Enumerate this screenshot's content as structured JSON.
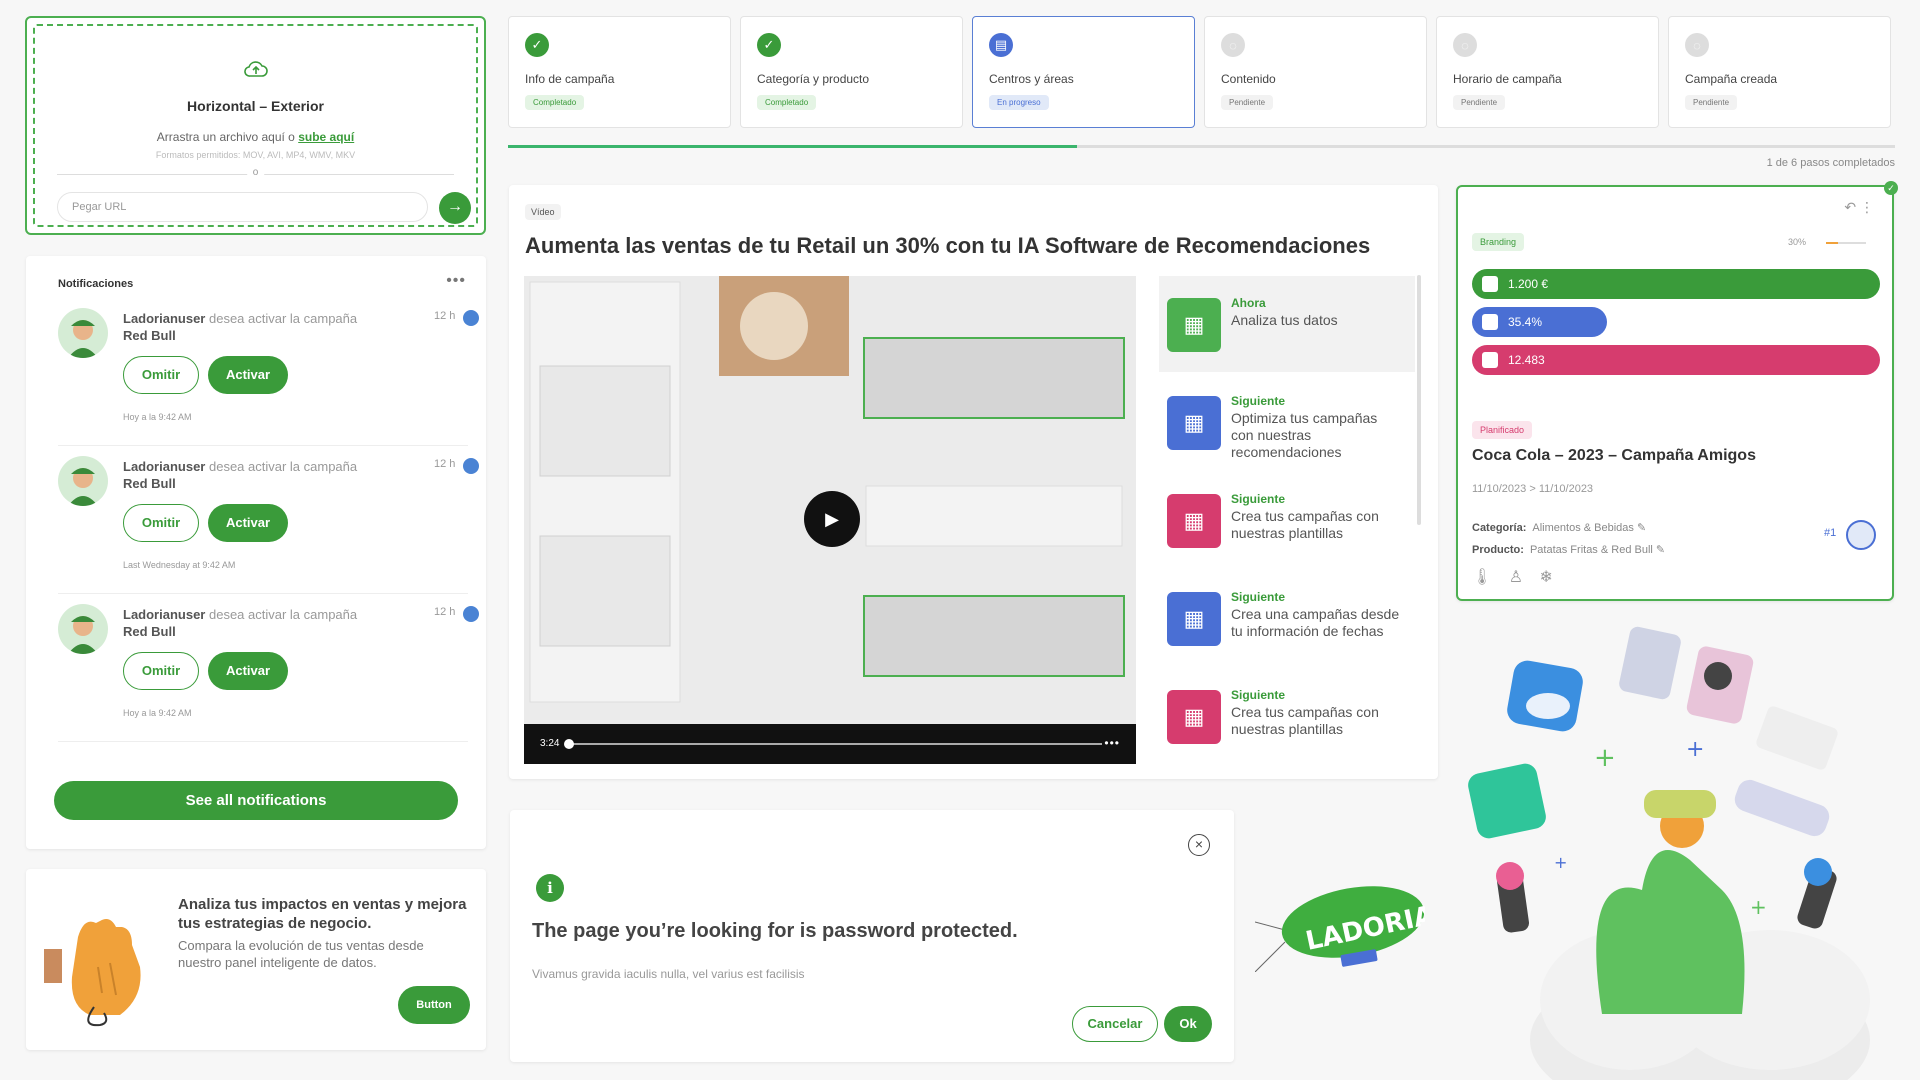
{
  "upload": {
    "title": "Horizontal – Exterior",
    "drop_text": "Arrastra un archivo aquí o",
    "drop_link": "sube aquí",
    "formats": "Formatos permitidos: MOV, AVI, MP4, WMV, MKV",
    "or": "o",
    "url_placeholder": "Pegar URL"
  },
  "notifications": {
    "header": "Notificaciones",
    "items": [
      {
        "user": "Ladorianuser",
        "text": "desea activar la campaña",
        "campaign": "Red Bull",
        "time": "12 h",
        "omit": "Omitir",
        "activate": "Activar",
        "stamp": "Hoy a la 9:42 AM"
      },
      {
        "user": "Ladorianuser",
        "text": "desea activar la campaña",
        "campaign": "Red Bull",
        "time": "12 h",
        "omit": "Omitir",
        "activate": "Activar",
        "stamp": "Last Wednesday at 9:42 AM"
      },
      {
        "user": "Ladorianuser",
        "text": "desea activar la campaña",
        "campaign": "Red Bull",
        "time": "12 h",
        "omit": "Omitir",
        "activate": "Activar",
        "stamp": "Hoy a la 9:42 AM"
      }
    ],
    "see_all": "See all notifications"
  },
  "analiza": {
    "heading": "Analiza tus impactos en ventas y mejora tus estrategias de negocio.",
    "body": "Compara la evolución de tus ventas desde nuestro panel inteligente de datos.",
    "button": "Button"
  },
  "steps": [
    {
      "label": "Info de campaña",
      "status": "Completado",
      "state": "done"
    },
    {
      "label": "Categoría y producto",
      "status": "Completado",
      "state": "done"
    },
    {
      "label": "Centros y áreas",
      "status": "En progreso",
      "state": "prog"
    },
    {
      "label": "Contenido",
      "status": "Pendiente",
      "state": "pend"
    },
    {
      "label": "Horario de campaña",
      "status": "Pendiente",
      "state": "pend"
    },
    {
      "label": "Campaña creada",
      "status": "Pendiente",
      "state": "pend"
    }
  ],
  "progress": {
    "text": "1 de 6 pasos completados",
    "fraction": 0.41
  },
  "video": {
    "tag": "Vídeo",
    "title": "Aumenta las ventas de tu Retail un 30% con tu IA Software de Recomendaciones",
    "time": "3:24",
    "recs": [
      {
        "kicker": "Ahora",
        "desc": "Analiza tus datos",
        "color": "#4caf50"
      },
      {
        "kicker": "Siguiente",
        "desc": "Optimiza tus campañas con nuestras recomendaciones",
        "color": "#4a6fd4"
      },
      {
        "kicker": "Siguiente",
        "desc": "Crea tus campañas con nuestras plantillas",
        "color": "#d63c6e"
      },
      {
        "kicker": "Siguiente",
        "desc": "Crea una campañas desde tu información de fechas",
        "color": "#4a6fd4"
      },
      {
        "kicker": "Siguiente",
        "desc": "Crea tus campañas con nuestras plantillas",
        "color": "#d63c6e"
      }
    ]
  },
  "campaign": {
    "badge": "Branding",
    "percent": "30%",
    "metrics": [
      {
        "value": "1.200 €",
        "color": "#3a9b3a",
        "fraction": 1.0
      },
      {
        "value": "35.4%",
        "color": "#4a6fd4",
        "fraction": 0.33
      },
      {
        "value": "12.483",
        "color": "#d63c6e",
        "fraction": 1.0
      }
    ],
    "status": "Planificado",
    "title": "Coca Cola – 2023 – Campaña Amigos",
    "date_from": "11/10/2023",
    "date_sep": ">",
    "date_to": "11/10/2023",
    "category_label": "Categoría:",
    "category": "Alimentos & Bebidas",
    "product_label": "Producto:",
    "product": "Patatas Fritas & Red Bull",
    "rank": "#1"
  },
  "modal": {
    "question": "The page you’re looking for is password protected.",
    "sub": "Vivamus gravida iaculis nulla, vel varius est facilisis",
    "cancel": "Cancelar",
    "ok": "Ok"
  },
  "blimp_text": "LADORIAN"
}
